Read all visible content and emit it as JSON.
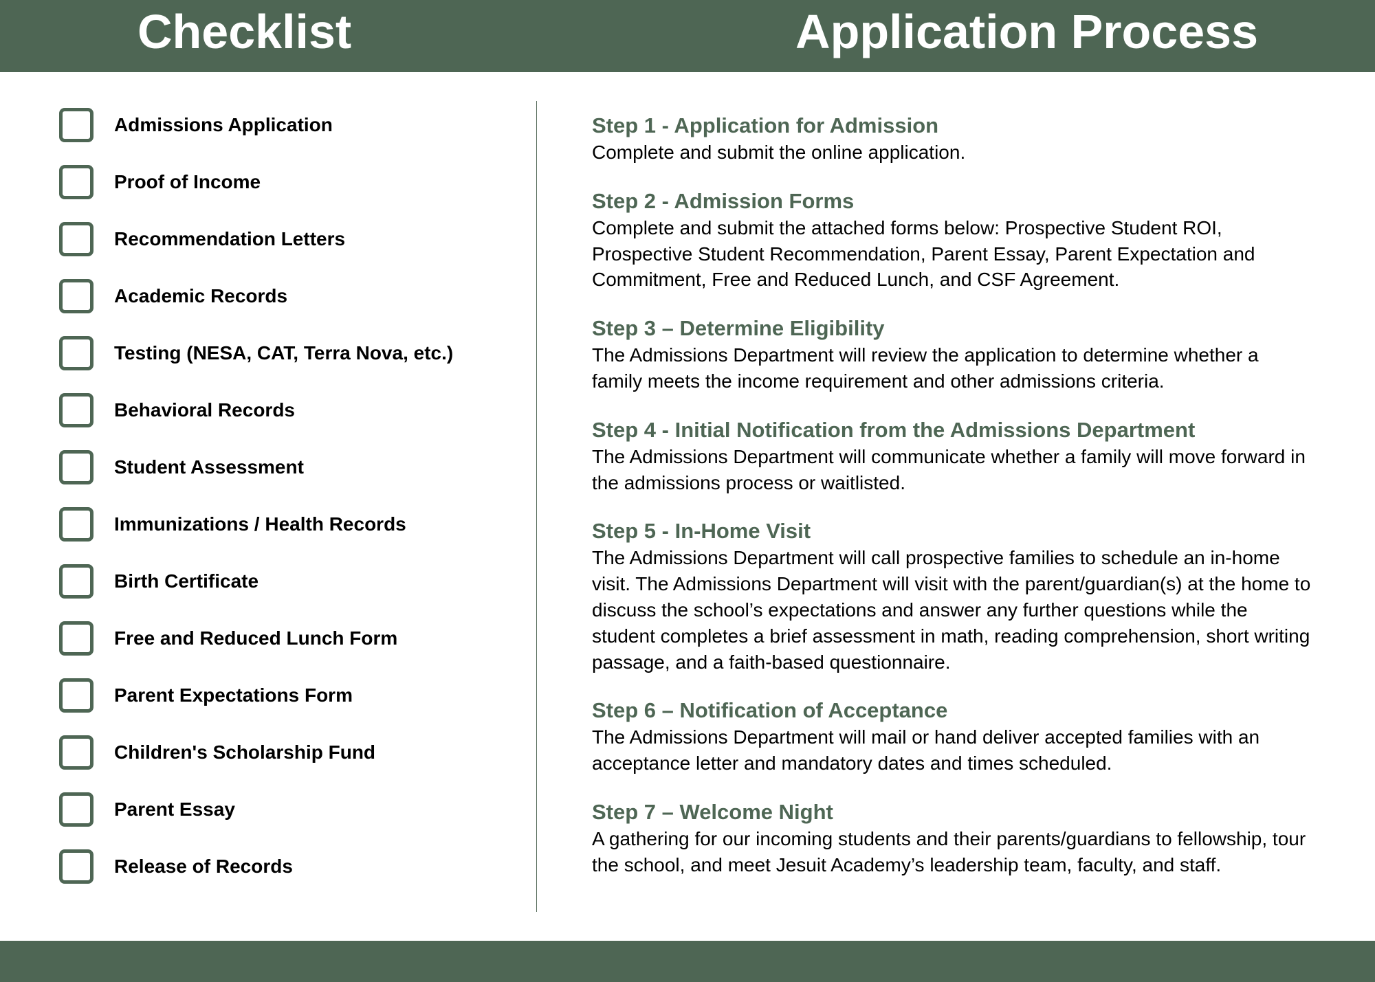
{
  "header": {
    "left": "Checklist",
    "right": "Application Process"
  },
  "checklist": [
    "Admissions Application",
    "Proof of Income",
    "Recommendation Letters",
    "Academic Records",
    "Testing (NESA, CAT, Terra Nova, etc.)",
    "Behavioral Records",
    "Student Assessment",
    "Immunizations / Health Records",
    "Birth Certificate",
    "Free and Reduced Lunch Form",
    "Parent Expectations Form",
    "Children's Scholarship Fund",
    "Parent Essay",
    "Release of Records"
  ],
  "steps": [
    {
      "title": "Step 1 - Application for Admission",
      "body": "Complete and submit the online application."
    },
    {
      "title": "Step 2 - Admission Forms",
      "body": "Complete and submit the attached forms below: Prospective Student ROI, Prospective Student Recommendation, Parent Essay, Parent Expectation and Commitment, Free and Reduced Lunch, and CSF Agreement."
    },
    {
      "title": "Step 3 – Determine Eligibility",
      "body": "The Admissions Department will review the application to determine whether a family meets the income requirement and other admissions criteria."
    },
    {
      "title": "Step 4 - Initial Notification from the Admissions Department",
      "body": "The Admissions Department will communicate whether a family will move forward in the admissions process or waitlisted."
    },
    {
      "title": "Step 5 - In-Home Visit",
      "body": "The Admissions Department will call prospective families to schedule an in-home visit. The Admissions Department will visit with the parent/guardian(s) at the home to discuss the school’s expectations and answer any further questions while the student completes a brief assessment in math, reading comprehension, short writing passage, and a faith-based questionnaire."
    },
    {
      "title": "Step 6 – Notification of Acceptance",
      "body": "The Admissions Department will mail or hand deliver accepted families with an acceptance letter and mandatory dates and times scheduled."
    },
    {
      "title": "Step 7 – Welcome Night",
      "body": "A gathering for our incoming students and their parents/guardians to fellowship, tour the school, and meet Jesuit Academy’s leadership team, faculty, and staff."
    }
  ]
}
